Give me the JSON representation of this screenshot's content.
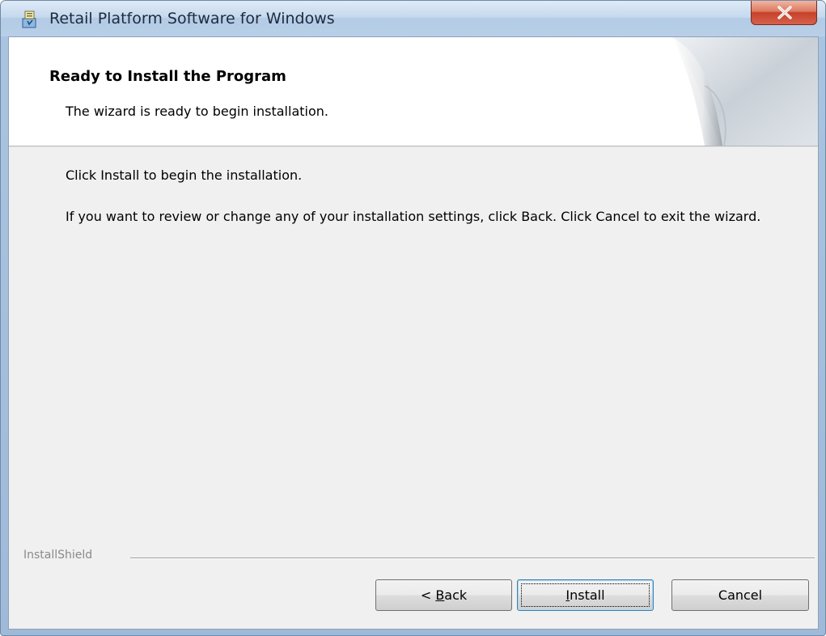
{
  "window": {
    "title": "Retail Platform Software for Windows",
    "close_label": "X"
  },
  "banner": {
    "title": "Ready to Install the Program",
    "subtitle": "The wizard is ready to begin installation."
  },
  "body": {
    "paragraph1": "Click Install to begin the installation.",
    "paragraph2": "If you want to review or change any of your installation settings, click Back. Click Cancel to exit the wizard."
  },
  "footer": {
    "brand": "InstallShield"
  },
  "buttons": {
    "back": {
      "prefix": "< ",
      "mnemonic": "B",
      "rest": "ack"
    },
    "install": {
      "prefix": "",
      "mnemonic": "I",
      "rest": "nstall"
    },
    "cancel": {
      "label": "Cancel"
    }
  },
  "icons": {
    "app": "installer-package-icon",
    "close": "close-icon",
    "banner": "page-curl-graphic"
  },
  "colors": {
    "titlebar": "#c6d9ee",
    "close_button": "#c6412a",
    "dialog_background": "#f0f0f0",
    "banner_background": "#ffffff",
    "default_button_border": "#3c7fb1"
  }
}
